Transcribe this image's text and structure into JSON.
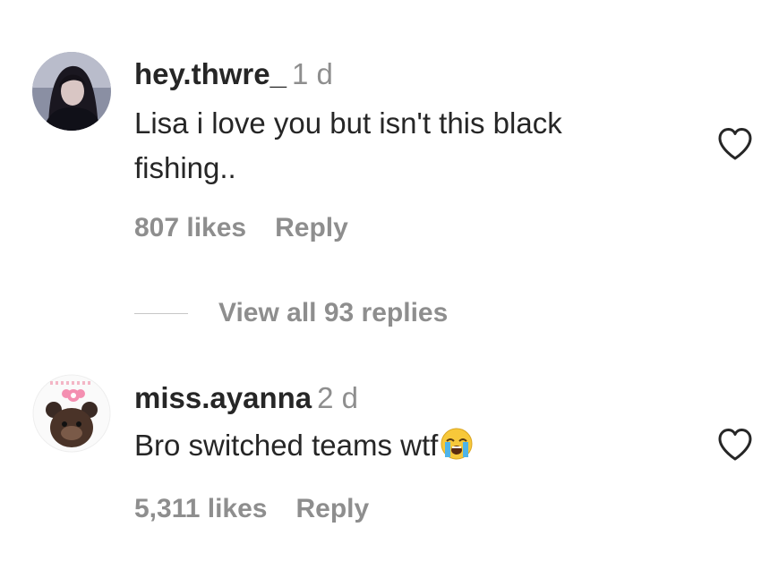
{
  "comments": [
    {
      "username": "hey.thwre_",
      "time": "1 d",
      "text_line1": "Lisa i love you but isn't this black",
      "text_line2": "fishing..",
      "likes": "807 likes",
      "reply_label": "Reply",
      "avatar_icon": "user-avatar-dark-hair",
      "like_icon": "heart-outline-icon"
    },
    {
      "username": "miss.ayanna",
      "time": "2 d",
      "text": "Bro switched teams wtf",
      "emoji_icon": "loudly-crying-face-emoji",
      "likes": "5,311 likes",
      "reply_label": "Reply",
      "avatar_icon": "user-avatar-bear-with-bow",
      "like_icon": "heart-outline-icon"
    }
  ],
  "view_replies": {
    "label": "View all 93 replies"
  },
  "colors": {
    "primary_text": "#262626",
    "secondary_text": "#8e8e8e",
    "divider": "#c7c7c7"
  }
}
